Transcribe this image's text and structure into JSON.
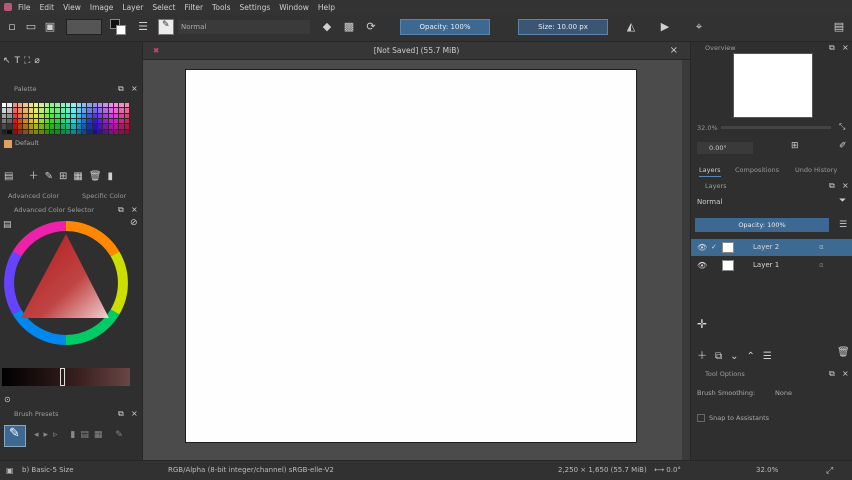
{
  "menu": [
    "File",
    "Edit",
    "View",
    "Image",
    "Layer",
    "Select",
    "Filter",
    "Tools",
    "Settings",
    "Window",
    "Help"
  ],
  "toolbar": {
    "brush_preset_name": "Normal",
    "opacity_label": "Opacity: 100%",
    "size_label": "Size: 10.00 px"
  },
  "document": {
    "title": "[Not Saved] (55.7 MiB)"
  },
  "left_dock": {
    "palette_header": "Palette",
    "palette_name": "Default",
    "palette_tabs": [
      "Advanced Color",
      "Specific Color"
    ],
    "selector_header": "Advanced Color Selector",
    "brush_presets_header": "Brush Presets"
  },
  "right_dock": {
    "overview_header": "Overview",
    "zoom_label": "32.0%",
    "rotation_label": "0.00°",
    "tabs": [
      "Layers",
      "Compositions",
      "Undo History"
    ],
    "layers_header": "Layers",
    "blend_mode": "Normal",
    "opacity_bar": "Opacity: 100%",
    "layers": [
      {
        "name": "Layer 2",
        "active": true
      },
      {
        "name": "Layer 1",
        "active": false
      }
    ],
    "tool_options_header": "Tool Options",
    "smoothing_label": "Brush Smoothing:",
    "smoothing_value": "None",
    "snap_label": "Snap to Assistants"
  },
  "status": {
    "brush": "b) Basic-5 Size",
    "color_info": "RGB/Alpha (8-bit integer/channel)  sRGB-elle-V2",
    "dimensions": "2,250 × 1,650 (55.7 MiB)",
    "zoom": "32.0%"
  },
  "colors": {
    "accent": "#3c6891",
    "page": "#fefefe",
    "canvas_bg": "#4b4b4b"
  }
}
